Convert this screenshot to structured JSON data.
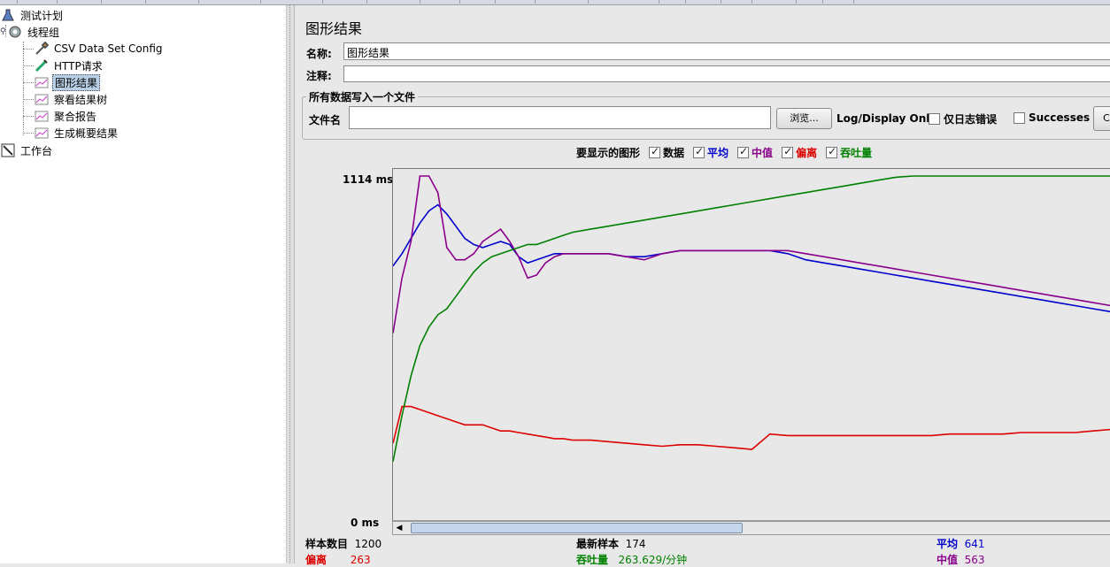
{
  "tree": {
    "items": [
      {
        "label": "测试计划",
        "icon": "flask-icon"
      },
      {
        "label": "线程组",
        "icon": "gear-icon"
      },
      {
        "label": "CSV Data Set Config",
        "icon": "wrench-icon"
      },
      {
        "label": "HTTP请求",
        "icon": "pipette-icon"
      },
      {
        "label": "图形结果",
        "icon": "chart-icon"
      },
      {
        "label": "察看结果树",
        "icon": "chart-icon"
      },
      {
        "label": "聚合报告",
        "icon": "chart-icon"
      },
      {
        "label": "生成概要结果",
        "icon": "chart-icon"
      },
      {
        "label": "工作台",
        "icon": "workbench-icon"
      }
    ]
  },
  "panel": {
    "title": "图形结果",
    "name_label": "名称:",
    "name_value": "图形结果",
    "comment_label": "注释:",
    "comment_value": "",
    "group_title": "所有数据写入一个文件",
    "filename_label": "文件名",
    "filename_value": "",
    "browse_label": "浏览...",
    "log_display": "Log/Display Only:",
    "errors_only": "仅日志错误",
    "successes": "Successes",
    "configure_label": "C"
  },
  "graph_options": {
    "label": "要显示的图形",
    "items": [
      {
        "label": "数据",
        "checked": true,
        "color": "#000000"
      },
      {
        "label": "平均",
        "checked": true,
        "color": "#0000cc"
      },
      {
        "label": "中值",
        "checked": true,
        "color": "#8b008b"
      },
      {
        "label": "偏离",
        "checked": true,
        "color": "#dd0000"
      },
      {
        "label": "吞吐量",
        "checked": true,
        "color": "#008000"
      }
    ]
  },
  "chart_data": {
    "type": "line",
    "y_max_label": "1114  ms",
    "y_min_label": "0  ms",
    "ylim": [
      0,
      1114
    ],
    "series": [
      {
        "name": "平均",
        "color": "#0000cc",
        "x": [
          0,
          5,
          10,
          15,
          20,
          25,
          30,
          35,
          40,
          45,
          50,
          55,
          60,
          65,
          70,
          75,
          80,
          85,
          90,
          95,
          100,
          110,
          120,
          130,
          140,
          150,
          160,
          170,
          180,
          190,
          200,
          210,
          220,
          230,
          240,
          250,
          260,
          270,
          280,
          290,
          300,
          310,
          320,
          330,
          340,
          350,
          360,
          370,
          380,
          390,
          400
        ],
        "y": [
          820,
          860,
          910,
          960,
          1000,
          1020,
          990,
          950,
          910,
          890,
          880,
          890,
          900,
          890,
          850,
          830,
          840,
          850,
          860,
          860,
          860,
          860,
          860,
          850,
          850,
          860,
          870,
          870,
          870,
          870,
          870,
          870,
          860,
          840,
          830,
          820,
          810,
          800,
          790,
          780,
          770,
          760,
          750,
          740,
          730,
          720,
          710,
          700,
          690,
          680,
          670
        ]
      },
      {
        "name": "中值",
        "color": "#8b008b",
        "x": [
          0,
          5,
          10,
          15,
          20,
          25,
          30,
          35,
          40,
          45,
          50,
          55,
          60,
          65,
          70,
          75,
          80,
          85,
          90,
          95,
          100,
          110,
          120,
          130,
          140,
          150,
          160,
          170,
          180,
          190,
          200,
          210,
          220,
          230,
          240,
          250,
          260,
          270,
          280,
          290,
          300,
          310,
          320,
          330,
          340,
          350,
          360,
          370,
          380,
          390,
          400
        ],
        "y": [
          600,
          780,
          900,
          1114,
          1114,
          1060,
          880,
          840,
          840,
          860,
          900,
          920,
          940,
          900,
          850,
          780,
          790,
          830,
          850,
          860,
          860,
          860,
          860,
          850,
          840,
          860,
          870,
          870,
          870,
          870,
          870,
          870,
          870,
          860,
          850,
          840,
          830,
          820,
          810,
          800,
          790,
          780,
          770,
          760,
          750,
          740,
          730,
          720,
          710,
          700,
          690
        ]
      },
      {
        "name": "偏离",
        "color": "#dd0000",
        "x": [
          0,
          5,
          10,
          15,
          20,
          25,
          30,
          35,
          40,
          45,
          50,
          55,
          60,
          65,
          70,
          75,
          80,
          85,
          90,
          95,
          100,
          110,
          120,
          130,
          140,
          150,
          160,
          170,
          180,
          190,
          200,
          210,
          220,
          230,
          240,
          250,
          260,
          270,
          280,
          290,
          300,
          310,
          320,
          330,
          340,
          350,
          360,
          370,
          380,
          390,
          400
        ],
        "y": [
          240,
          360,
          360,
          350,
          340,
          330,
          320,
          310,
          300,
          300,
          300,
          290,
          280,
          280,
          275,
          270,
          265,
          260,
          255,
          255,
          250,
          250,
          245,
          240,
          235,
          230,
          235,
          235,
          230,
          225,
          220,
          270,
          265,
          265,
          265,
          265,
          265,
          265,
          265,
          265,
          265,
          270,
          270,
          270,
          270,
          275,
          275,
          275,
          275,
          280,
          285
        ]
      },
      {
        "name": "吞吐量",
        "color": "#008000",
        "x": [
          0,
          5,
          10,
          15,
          20,
          25,
          30,
          35,
          40,
          45,
          50,
          55,
          60,
          65,
          70,
          75,
          80,
          85,
          90,
          95,
          100,
          110,
          120,
          130,
          140,
          150,
          160,
          170,
          180,
          190,
          200,
          210,
          220,
          230,
          240,
          250,
          260,
          270,
          280,
          290,
          300,
          310,
          320,
          330,
          340,
          350,
          360,
          370,
          380,
          390,
          400
        ],
        "y": [
          180,
          330,
          460,
          560,
          620,
          660,
          680,
          720,
          760,
          800,
          830,
          850,
          860,
          870,
          880,
          890,
          890,
          900,
          910,
          920,
          930,
          940,
          950,
          960,
          970,
          980,
          990,
          1000,
          1010,
          1020,
          1030,
          1040,
          1050,
          1060,
          1070,
          1080,
          1090,
          1100,
          1110,
          1114,
          1114,
          1114,
          1114,
          1114,
          1114,
          1114,
          1114,
          1114,
          1114,
          1114,
          1114
        ]
      }
    ]
  },
  "stats": {
    "sample_count_label": "样本数目",
    "sample_count_value": "1200",
    "latest_label": "最新样本",
    "latest_value": "174",
    "avg_label": "平均",
    "avg_value": "641",
    "dev_label": "偏离",
    "dev_value": "263",
    "throughput_label": "吞吐量",
    "throughput_value": "263.629/分钟",
    "median_label": "中值",
    "median_value": "563"
  }
}
